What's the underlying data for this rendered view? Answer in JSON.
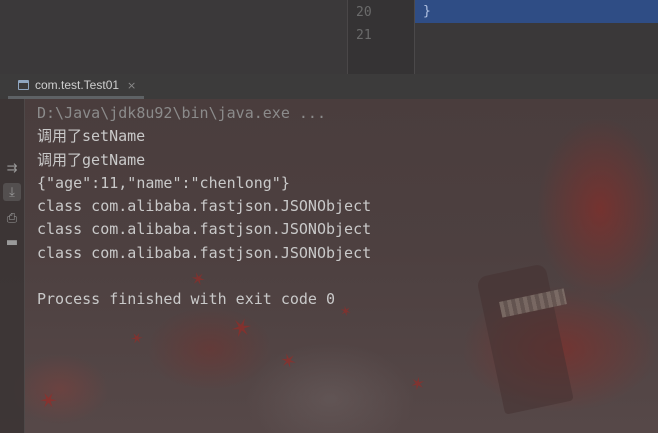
{
  "editor": {
    "line_numbers": [
      "20",
      "21"
    ],
    "highlighted_code": "}"
  },
  "run_panel": {
    "tab_label": "com.test.Test01",
    "tab_close": "×"
  },
  "toolbar": {
    "icons": [
      "soft-wrap-icon",
      "scroll-to-end-icon",
      "print-icon",
      "clear-all-icon"
    ]
  },
  "console": {
    "command": "D:\\Java\\jdk8u92\\bin\\java.exe ...",
    "lines": [
      "调用了setName",
      "调用了getName",
      "{\"age\":11,\"name\":\"chenlong\"}",
      "class com.alibaba.fastjson.JSONObject",
      "class com.alibaba.fastjson.JSONObject",
      "class com.alibaba.fastjson.JSONObject"
    ],
    "exit_message": "Process finished with exit code 0"
  },
  "colors": {
    "highlight": "#2f4d85",
    "console_text": "#c9c9c9",
    "command_text": "#8b8b8b"
  }
}
